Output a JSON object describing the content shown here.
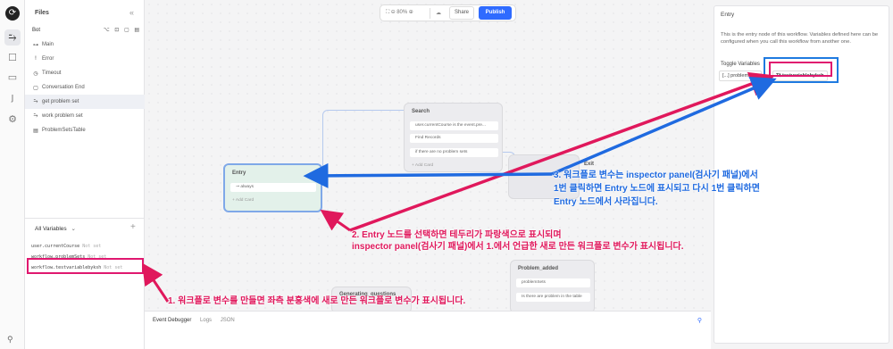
{
  "colors": {
    "accent": "#2f6bff",
    "annotation_pink": "#e0186f",
    "annotation_blue": "#1f7ae0",
    "entry_node_bg": "#e3f1ea"
  },
  "files": {
    "title": "Files",
    "bot_label": "Bot",
    "bot_tools": "⌥ ⊡ ▢ ▤",
    "items": [
      {
        "label": "Main",
        "icon": "flow-icon",
        "glyph": "⊶",
        "selected": false
      },
      {
        "label": "Error",
        "icon": "error-icon",
        "glyph": "!",
        "selected": false
      },
      {
        "label": "Timeout",
        "icon": "clock-icon",
        "glyph": "◷",
        "selected": false
      },
      {
        "label": "Conversation End",
        "icon": "end-icon",
        "glyph": "▢",
        "selected": false
      },
      {
        "label": "get problem set",
        "icon": "workflow-icon",
        "glyph": "⥲",
        "selected": true
      },
      {
        "label": "work problem set",
        "icon": "workflow-icon",
        "glyph": "⥲",
        "selected": false
      },
      {
        "label": "ProblemSetsTable",
        "icon": "table-icon",
        "glyph": "▤",
        "selected": false
      }
    ]
  },
  "variables": {
    "header": "All Variables",
    "caret": "⌄",
    "add_glyph": "+",
    "items": [
      {
        "name": "user.currentCourse",
        "status": "Not set"
      },
      {
        "name": "workflow.problemSets",
        "status": "Not set"
      },
      {
        "name": "workflow.testvariablebyksh",
        "status": "Not set"
      }
    ]
  },
  "toolbar": {
    "zoom": "⛶ ⊖ 80% ⊕",
    "cloud_glyph": "☁",
    "share_label": "Share",
    "publish_label": "Publish"
  },
  "nodes": {
    "entry": {
      "title": "Entry",
      "slot": "always",
      "add": "+ Add Card"
    },
    "search": {
      "title": "Search",
      "slots": [
        "user.currentCourse is the event.pre...",
        "Find Records",
        "if there are no problem sets"
      ],
      "add": "+ Add Card"
    },
    "exit": {
      "title": "Exit"
    },
    "problem": {
      "title": "Problem_added",
      "slots": [
        "problemSets",
        "Is there are problem in the table"
      ]
    },
    "gen": {
      "title": "Generating_questions"
    }
  },
  "debugger": {
    "tabs": [
      "Event Debugger",
      "Logs",
      "JSON"
    ],
    "pin_glyph": "⚲"
  },
  "inspector": {
    "title": "Entry",
    "description": "This is the entry node of this workflow. Variables defined here can be configured when you call this workflow from another one.",
    "toggle_label": "Toggle Variables",
    "chips": [
      "[...] problemSets",
      "T𝗍 testvariablebyksh"
    ]
  },
  "annotations": {
    "a1": "1. 워크플로 변수를 만들면 좌측 분홍색에 새로 만든 워크플로 변수가 표시됩니다.",
    "a2_line1": "2. Entry 노드를 선택하면 테두리가 파랑색으로 표시되며",
    "a2_line2": "inspector panel(검사기 패널)에서 1.에서 언급한 새로 만든 워크플로 변수가 표시됩니다.",
    "a3_line1": "3. 워크플로 변수는 inspector panel(검사기 패널)에서",
    "a3_line2": "1번 클릭하면 Entry 노드에 표시되고 다시 1번 클릭하면",
    "a3_line3": "Entry 노드에서 사라집니다."
  }
}
